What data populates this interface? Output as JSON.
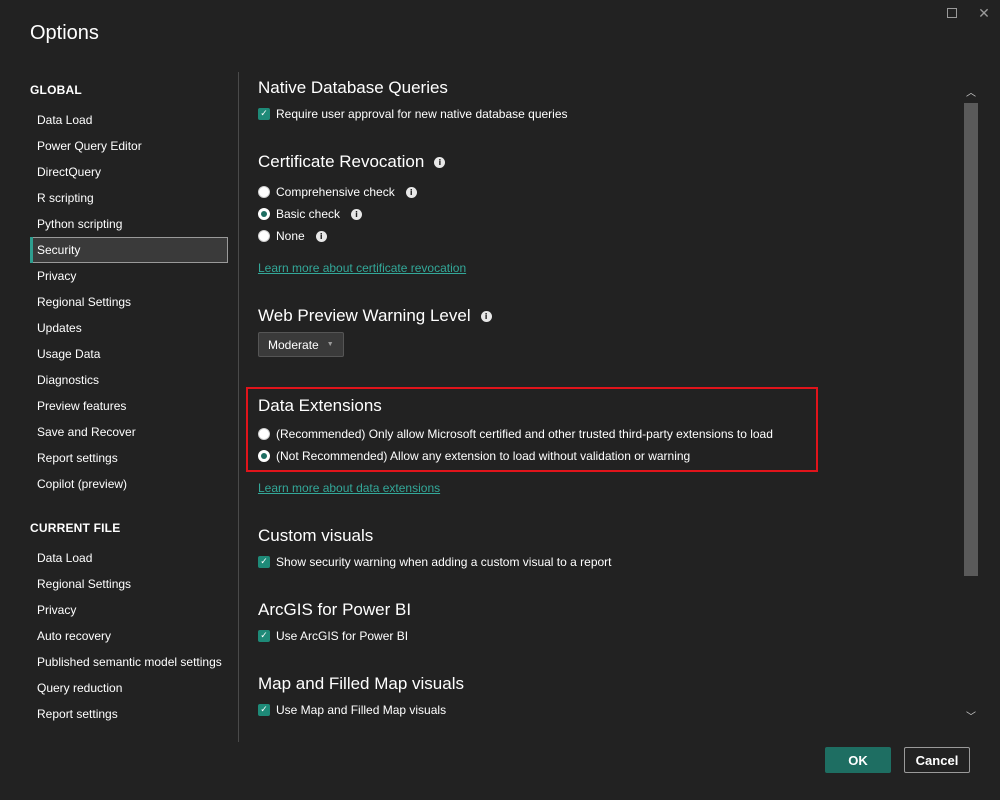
{
  "window": {
    "title": "Options",
    "maximize_icon": "maximize-icon",
    "close_glyph": "✕"
  },
  "sidebar": {
    "global_heading": "GLOBAL",
    "global_items": [
      {
        "label": "Data Load"
      },
      {
        "label": "Power Query Editor"
      },
      {
        "label": "DirectQuery"
      },
      {
        "label": "R scripting"
      },
      {
        "label": "Python scripting"
      },
      {
        "label": "Security",
        "selected": true
      },
      {
        "label": "Privacy"
      },
      {
        "label": "Regional Settings"
      },
      {
        "label": "Updates"
      },
      {
        "label": "Usage Data"
      },
      {
        "label": "Diagnostics"
      },
      {
        "label": "Preview features"
      },
      {
        "label": "Save and Recover"
      },
      {
        "label": "Report settings"
      },
      {
        "label": "Copilot (preview)"
      }
    ],
    "current_heading": "CURRENT FILE",
    "current_items": [
      {
        "label": "Data Load"
      },
      {
        "label": "Regional Settings"
      },
      {
        "label": "Privacy"
      },
      {
        "label": "Auto recovery"
      },
      {
        "label": "Published semantic model settings"
      },
      {
        "label": "Query reduction"
      },
      {
        "label": "Report settings"
      }
    ]
  },
  "content": {
    "native": {
      "heading": "Native Database Queries",
      "option": "Require user approval for new native database queries",
      "checked": true
    },
    "cert": {
      "heading": "Certificate Revocation",
      "options": [
        {
          "label": "Comprehensive check",
          "checked": false
        },
        {
          "label": "Basic check",
          "checked": true
        },
        {
          "label": "None",
          "checked": false
        }
      ],
      "link": "Learn more about certificate revocation"
    },
    "web_preview": {
      "heading": "Web Preview Warning Level",
      "selected": "Moderate"
    },
    "data_ext": {
      "heading": "Data Extensions",
      "options": [
        {
          "label": "(Recommended) Only allow Microsoft certified and other trusted third-party extensions to load",
          "checked": false
        },
        {
          "label": "(Not Recommended) Allow any extension to load without validation or warning",
          "checked": true
        }
      ],
      "link": "Learn more about data extensions"
    },
    "custom_visuals": {
      "heading": "Custom visuals",
      "option": "Show security warning when adding a custom visual to a report",
      "checked": true
    },
    "arcgis": {
      "heading": "ArcGIS for Power BI",
      "option": "Use ArcGIS for Power BI",
      "checked": true
    },
    "maps": {
      "heading": "Map and Filled Map visuals",
      "option": "Use Map and Filled Map visuals",
      "checked": true
    }
  },
  "footer": {
    "ok": "OK",
    "cancel": "Cancel"
  },
  "colors": {
    "background": "#222222",
    "accent": "#1e6e62",
    "link": "#33a899",
    "highlight": "#e0141b"
  }
}
